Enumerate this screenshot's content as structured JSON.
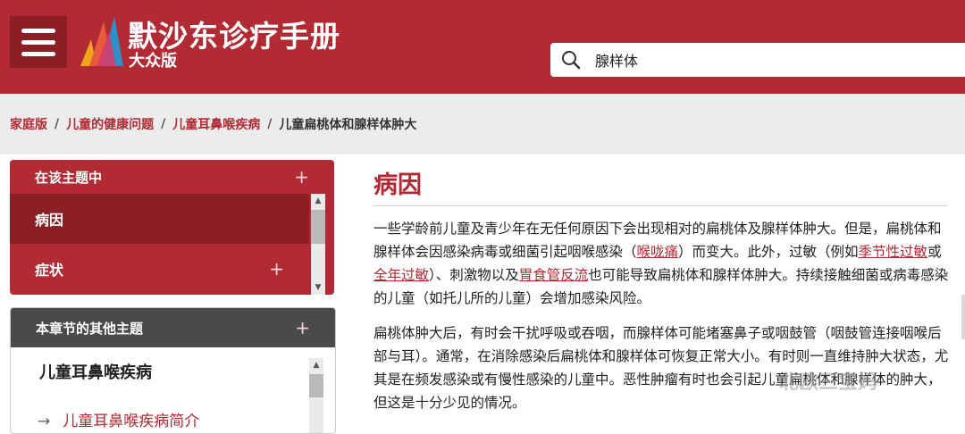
{
  "header": {
    "brand_title": "默沙东诊疗手册",
    "brand_sub": "大众版",
    "search_value": "腺样体"
  },
  "breadcrumb": {
    "items": [
      "家庭版",
      "儿童的健康问题",
      "儿童耳鼻喉疾病"
    ],
    "current": "儿童扁桃体和腺样体肿大"
  },
  "sidebar": {
    "topic_header": "在该主题中",
    "topic_items": [
      "病因",
      "症状"
    ],
    "other_header": "本章节的其他主题",
    "other_title": "儿童耳鼻喉疾病",
    "other_link": "儿童耳鼻喉疾病简介",
    "plus": "+",
    "arrow": "→"
  },
  "main": {
    "heading": "病因",
    "p1": {
      "t1": "一些学龄前儿童及青少年在无任何原因下会出现相对的扁桃体及腺样体肿大。但是，扁桃体和腺样体会因感染病毒或细菌引起咽喉感染（",
      "l1": "喉咙痛",
      "t2": "）而变大。此外，过敏（例如",
      "l2": "季节性过敏",
      "t3": "或",
      "l3": "全年过敏",
      "t4": "）、刺激物以及",
      "l4": "胃食管反流",
      "t5": "也可能导致扁桃体和腺样体肿大。持续接触细菌或病毒感染的儿童（如托儿所的儿童）会增加感染风险。"
    },
    "p2": "扁桃体肿大后，有时会干扰呼吸或吞咽，而腺样体可能堵塞鼻子或咽鼓管（咽鼓管连接咽喉后部与耳）。通常，在消除感染后扁桃体和腺样体可恢复正常大小。有时则一直维持肿大状态，尤其是在频发感染或有慢性感染的儿童中。恶性肿瘤有时也会引起儿童扁桃体和腺样体的肿大，但这是十分少见的情况。"
  },
  "watermark": "北欧三宝妈",
  "colors": {
    "brand": "#b22b34",
    "brand_dark": "#8c1e26"
  }
}
